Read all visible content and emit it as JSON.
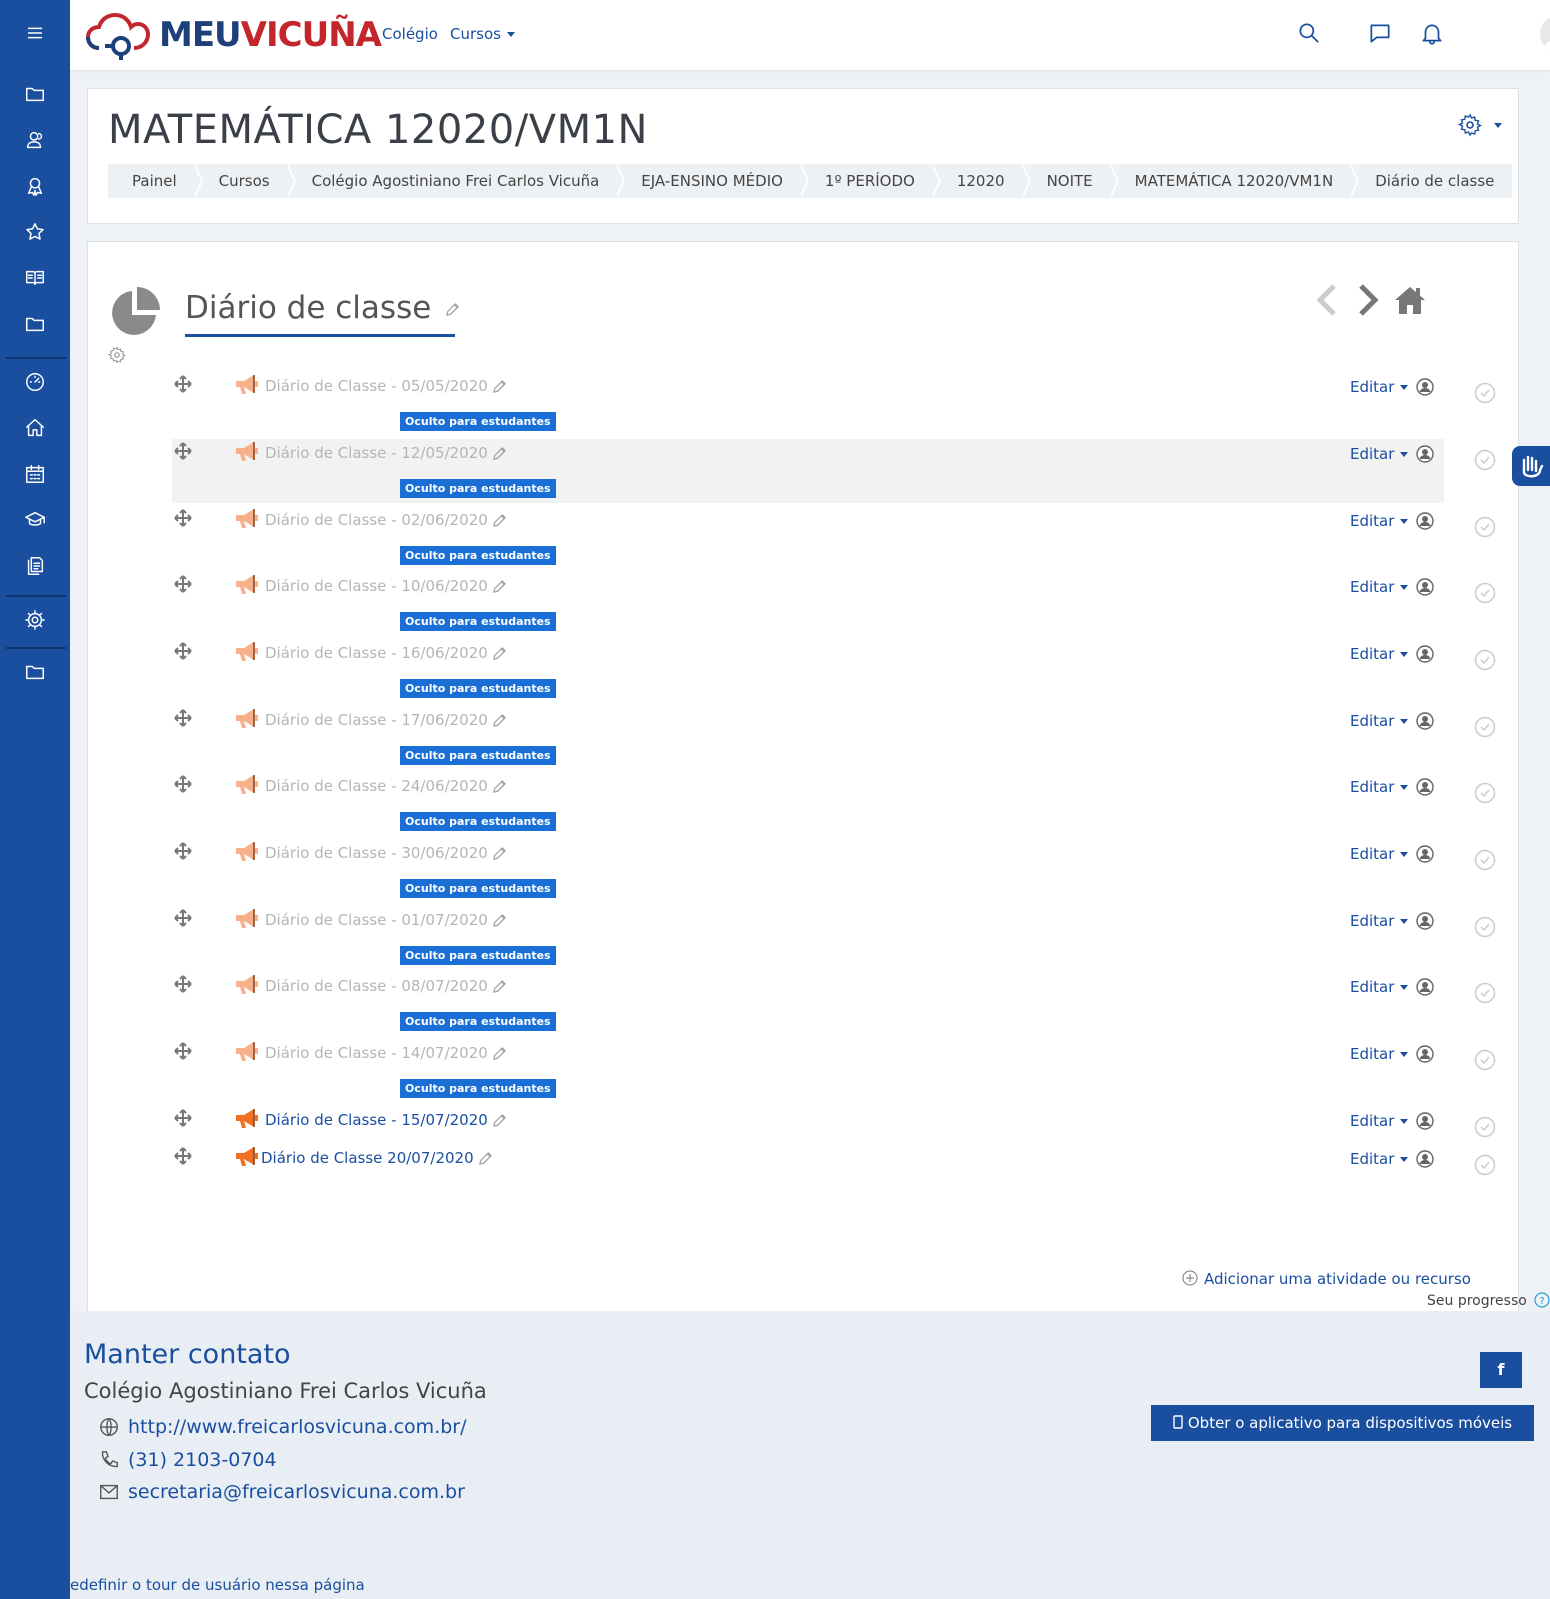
{
  "colors": {
    "primary": "#1a4fa0",
    "sidebar": "#1a4fa0",
    "badge": "#1a6fd6",
    "logo_blue": "#1d3f7a",
    "logo_red": "#c4262e",
    "activity_orange": "#f36f21"
  },
  "brand": {
    "logo_part1": "MEU",
    "logo_part2": "VICUÑA"
  },
  "topnav": {
    "link_colegio": "Colégio",
    "link_cursos": "Cursos"
  },
  "sidebar": {
    "icons": [
      "menu-icon",
      "folder-icon",
      "users-icon",
      "badge-icon",
      "star-icon",
      "book-icon",
      "folder-icon",
      "dashboard-icon",
      "home-icon",
      "calendar-icon",
      "graduation-icon",
      "files-icon",
      "gear-icon",
      "folder-icon"
    ]
  },
  "course": {
    "title": "MATEMÁTICA 12020/VM1N",
    "breadcrumb": [
      "Painel",
      "Cursos",
      "Colégio Agostiniano Frei Carlos Vicuña",
      "EJA-ENSINO MÉDIO",
      "1º PERÍODO",
      "12020",
      "NOITE",
      "MATEMÁTICA 12020/VM1N",
      "Diário de classe"
    ]
  },
  "section": {
    "title": "Diário de classe"
  },
  "activities": [
    {
      "name": "Diário de Classe - 05/05/2020",
      "hidden": true
    },
    {
      "name": "Diário de Classe - 12/05/2020",
      "hidden": true
    },
    {
      "name": "Diário de Classe - 02/06/2020",
      "hidden": true
    },
    {
      "name": "Diário de Classe - 10/06/2020",
      "hidden": true
    },
    {
      "name": "Diário de Classe - 16/06/2020",
      "hidden": true
    },
    {
      "name": "Diário de Classe - 17/06/2020",
      "hidden": true
    },
    {
      "name": "Diário de Classe - 24/06/2020",
      "hidden": true
    },
    {
      "name": "Diário de Classe - 30/06/2020",
      "hidden": true
    },
    {
      "name": "Diário de Classe - 01/07/2020",
      "hidden": true
    },
    {
      "name": "Diário de Classe - 08/07/2020",
      "hidden": true
    },
    {
      "name": "Diário de Classe - 14/07/2020",
      "hidden": true
    },
    {
      "name": "Diário de Classe - 15/07/2020",
      "hidden": false
    },
    {
      "name": "Diário de Classe 20/07/2020",
      "hidden": false
    }
  ],
  "labels": {
    "hidden_badge": "Oculto para estudantes",
    "edit": "Editar",
    "add_activity": "Adicionar uma atividade ou recurso",
    "progress": "Seu progresso"
  },
  "footer": {
    "title": "Manter contato",
    "school": "Colégio Agostiniano Frei Carlos Vicuña",
    "website": "http://www.freicarlosvicuna.com.br/",
    "phone": "(31) 2103-0704",
    "email": "secretaria@freicarlosvicuna.com.br",
    "facebook": "f",
    "app_button": "Obter o aplicativo para dispositivos móveis",
    "tour_reset": "edefinir o tour de usuário nessa página"
  }
}
